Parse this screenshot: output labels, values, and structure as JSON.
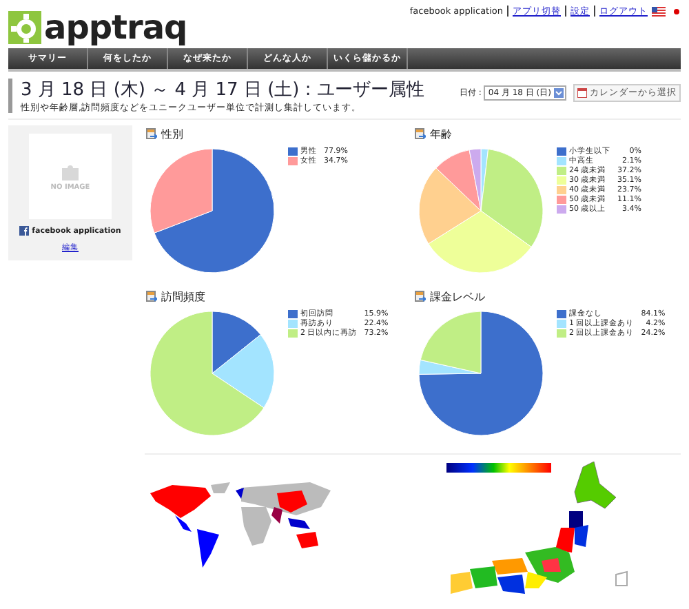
{
  "logo": {
    "text": "apptraq"
  },
  "header": {
    "app_name": "facebook application",
    "links": [
      "アプリ切替",
      "設定",
      "ログアウト"
    ]
  },
  "nav": [
    "サマリー",
    "何をしたか",
    "なぜ来たか",
    "どんな人か",
    "いくら儲かるか"
  ],
  "page": {
    "title": "3 月 18 日 (木) ～ 4 月 17 日 (土) : ユーザー属性",
    "subtitle": "性別や年齢層,訪問頻度などをユニークユーザー単位で計測し集計しています。"
  },
  "date_picker": {
    "label": "日付 :",
    "value": "04 月 18 日 (日)",
    "calendar_button": "カレンダーから選択"
  },
  "app_panel": {
    "image_text": "NO IMAGE",
    "name": "facebook application",
    "edit_link": "編集"
  },
  "charts": [
    {
      "title": "性別",
      "legend": [
        {
          "value": "77.9%",
          "color": "#3d6fcc"
        },
        {
          "value": "34.7%",
          "color": "#ff9a9a"
        }
      ],
      "chart_data": {
        "type": "pie",
        "categories": [
          "男性",
          "女性"
        ],
        "values": [
          69.18,
          30.82
        ]
      }
    },
    {
      "title": "年齢",
      "legend": [
        {
          "value": "0%",
          "color": "#3d6fcc"
        },
        {
          "value": "2.1%",
          "color": "#a3e4ff"
        },
        {
          "value": "37.2%",
          "color": "#c0ee85"
        },
        {
          "value": "35.1%",
          "color": "#eeff99"
        },
        {
          "value": "23.7%",
          "color": "#ffd08f"
        },
        {
          "value": "11.1%",
          "color": "#ff9a9a"
        },
        {
          "value": "3.4%",
          "color": "#ccaaee"
        }
      ],
      "chart_data": {
        "type": "pie",
        "categories": [
          "小学生以下",
          "中高生",
          "24 歳未満",
          "30 歳未満",
          "40 歳未満",
          "50 歳未満",
          "50 歳以上"
        ],
        "values": [
          0,
          1.87,
          33.04,
          31.17,
          21.05,
          9.86,
          3.01
        ]
      }
    },
    {
      "title": "訪問頻度",
      "legend": [
        {
          "value": "15.9%",
          "color": "#3d6fcc"
        },
        {
          "value": "22.4%",
          "color": "#a3e4ff"
        },
        {
          "value": "73.2%",
          "color": "#c0ee85"
        }
      ],
      "chart_data": {
        "type": "pie",
        "categories": [
          "初回訪問",
          "再訪あり",
          "2 日以内に再訪"
        ],
        "values": [
          14.26,
          20.09,
          65.65
        ]
      }
    },
    {
      "title": "課金レベル",
      "legend": [
        {
          "value": "84.1%",
          "color": "#3d6fcc"
        },
        {
          "value": "4.2%",
          "color": "#a3e4ff"
        },
        {
          "value": "24.2%",
          "color": "#c0ee85"
        }
      ],
      "chart_data": {
        "type": "pie",
        "categories": [
          "課金なし",
          "1 回以上課金あり",
          "2 回以上課金あり"
        ],
        "values": [
          74.76,
          3.73,
          21.51
        ]
      }
    }
  ]
}
